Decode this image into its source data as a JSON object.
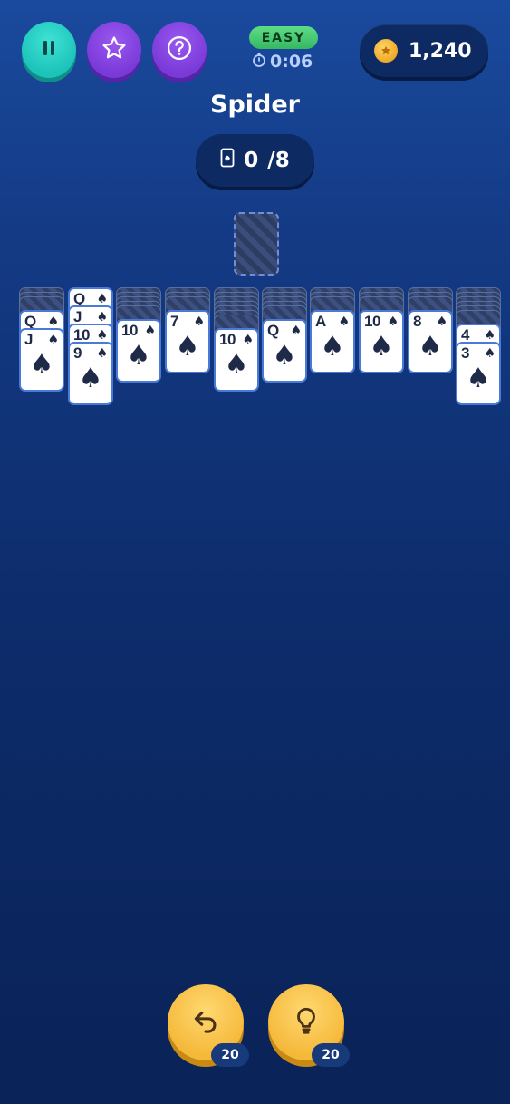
{
  "header": {
    "difficulty": "EASY",
    "timer": "0:06",
    "coins": "1,240"
  },
  "title": "Spider",
  "progress": {
    "completed": "0",
    "total": "/8"
  },
  "tableau": [
    {
      "facedown": 3,
      "cards": [
        {
          "rank": "Q",
          "suit": "♠"
        },
        {
          "rank": "J",
          "suit": "♠"
        }
      ]
    },
    {
      "facedown": 0,
      "cards": [
        {
          "rank": "Q",
          "suit": "♠"
        },
        {
          "rank": "J",
          "suit": "♠"
        },
        {
          "rank": "10",
          "suit": "♠"
        },
        {
          "rank": "9",
          "suit": "♠"
        }
      ]
    },
    {
      "facedown": 5,
      "cards": [
        {
          "rank": "10",
          "suit": "♠"
        }
      ]
    },
    {
      "facedown": 3,
      "cards": [
        {
          "rank": "7",
          "suit": "♠"
        }
      ]
    },
    {
      "facedown": 7,
      "cards": [
        {
          "rank": "10",
          "suit": "♠"
        }
      ]
    },
    {
      "facedown": 5,
      "cards": [
        {
          "rank": "Q",
          "suit": "♠"
        }
      ]
    },
    {
      "facedown": 3,
      "cards": [
        {
          "rank": "A",
          "suit": "♠"
        }
      ]
    },
    {
      "facedown": 3,
      "cards": [
        {
          "rank": "10",
          "suit": "♠"
        }
      ]
    },
    {
      "facedown": 3,
      "cards": [
        {
          "rank": "8",
          "suit": "♠"
        }
      ]
    },
    {
      "facedown": 6,
      "cards": [
        {
          "rank": "4",
          "suit": "♠"
        },
        {
          "rank": "3",
          "suit": "♠"
        }
      ]
    }
  ],
  "actions": {
    "undo_count": "20",
    "hint_count": "20"
  },
  "icons": {
    "pause": "pause-icon",
    "star": "star-icon",
    "help": "help-icon",
    "timer": "stopwatch-icon",
    "coin": "coin-icon",
    "card": "card-icon",
    "undo": "undo-icon",
    "hint": "lightbulb-icon"
  },
  "colors": {
    "teal_button": "#1cc3b8",
    "purple_button": "#7a3ad8",
    "easy_badge": "#35b862",
    "gold_button": "#f5b93a",
    "background": "#0d2c6b"
  }
}
